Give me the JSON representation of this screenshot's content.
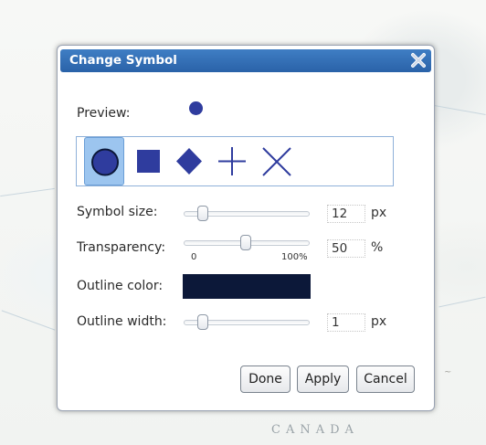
{
  "dialog": {
    "title": "Change Symbol",
    "preview_label": "Preview:",
    "preview_color": "#2f3c9e",
    "symbols": [
      {
        "name": "circle",
        "selected": true
      },
      {
        "name": "square",
        "selected": false
      },
      {
        "name": "diamond",
        "selected": false
      },
      {
        "name": "cross",
        "selected": false
      },
      {
        "name": "x",
        "selected": false
      }
    ],
    "symbol_size": {
      "label": "Symbol size:",
      "value": "12",
      "unit": "px"
    },
    "transparency": {
      "label": "Transparency:",
      "value": "50",
      "unit": "%",
      "min_label": "0",
      "max_label": "100%"
    },
    "outline_color": {
      "label": "Outline color:",
      "color": "#0c1839"
    },
    "outline_width": {
      "label": "Outline width:",
      "value": "1",
      "unit": "px"
    },
    "buttons": {
      "done": "Done",
      "apply": "Apply",
      "cancel": "Cancel"
    }
  },
  "map": {
    "country_label": "CANADA"
  },
  "colors": {
    "title_bar": "#2f6bb3",
    "symbol_fill": "#2f3c9e",
    "selected_bg": "#9cc5ef"
  }
}
